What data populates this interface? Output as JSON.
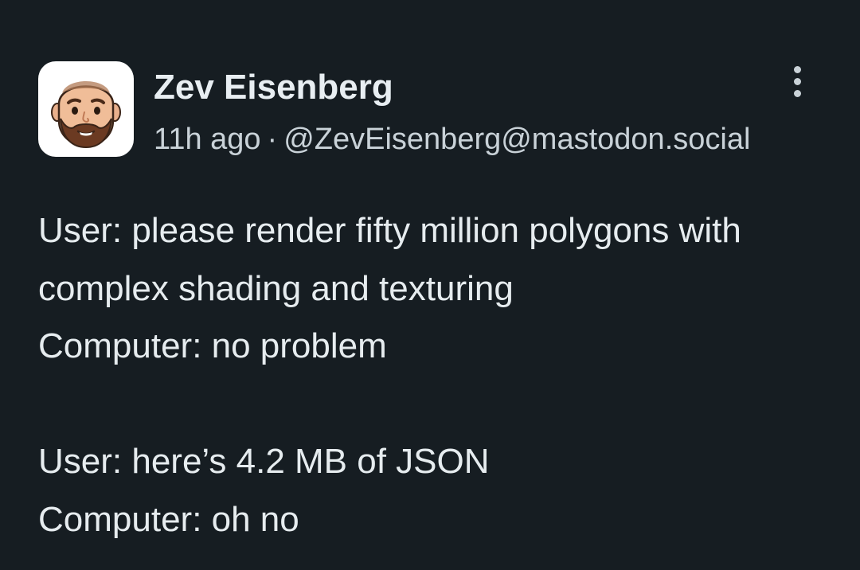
{
  "post": {
    "author": {
      "display_name": "Zev Eisenberg",
      "handle": "@ZevEisenberg@mastodon.social",
      "avatar_icon": "bitmoji-avatar-icon"
    },
    "timestamp": "11h ago",
    "separator": "·",
    "more_icon": "vertical-ellipsis-icon",
    "content_lines": [
      "User: please render fifty million polygons with",
      "complex shading and texturing",
      "Computer: no problem",
      "",
      "User: here’s 4.2 MB of JSON",
      "Computer: oh no"
    ]
  },
  "colors": {
    "background": "#161d22",
    "text_primary": "#e6ecef",
    "text_secondary": "#c9d2d8"
  }
}
